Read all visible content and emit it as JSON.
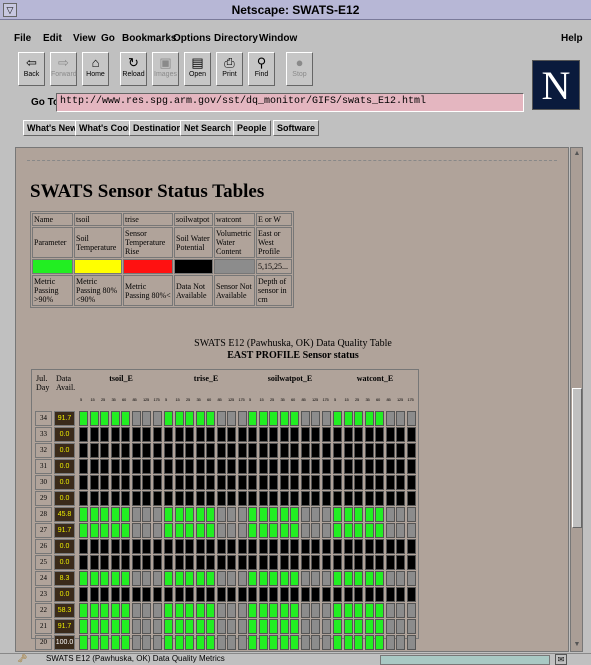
{
  "window": {
    "title": "Netscape: SWATS-E12",
    "control_glyph": "▽"
  },
  "menu": {
    "items": [
      "File",
      "Edit",
      "View",
      "Go",
      "Bookmarks",
      "Options",
      "Directory",
      "Window"
    ],
    "help": "Help"
  },
  "toolbar": {
    "buttons": [
      {
        "label": "Back",
        "icon": "back-arrow-icon",
        "enabled": true
      },
      {
        "label": "Forward",
        "icon": "forward-arrow-icon",
        "enabled": false
      },
      {
        "label": "Home",
        "icon": "home-icon",
        "enabled": true
      },
      {
        "label": "Reload",
        "icon": "reload-icon",
        "enabled": true
      },
      {
        "label": "Images",
        "icon": "images-icon",
        "enabled": false
      },
      {
        "label": "Open",
        "icon": "open-icon",
        "enabled": true
      },
      {
        "label": "Print",
        "icon": "print-icon",
        "enabled": true
      },
      {
        "label": "Find",
        "icon": "find-icon",
        "enabled": true
      },
      {
        "label": "Stop",
        "icon": "stop-icon",
        "enabled": false
      }
    ]
  },
  "goto": {
    "label": "Go To:",
    "url": "http://www.res.spg.arm.gov/sst/dq_monitor/GIFS/swats_E12.html"
  },
  "directory_buttons": [
    "What's New?",
    "What's Cool?",
    "Destinations",
    "Net Search",
    "People",
    "Software"
  ],
  "logo": {
    "letter": "N"
  },
  "page": {
    "heading": "SWATS Sensor Status Tables",
    "legend": {
      "rows": [
        [
          "Name",
          "tsoil",
          "trise",
          "soilwatpot",
          "watcont",
          "E or W"
        ],
        [
          "Parameter",
          "Soil Temperature",
          "Sensor Temperature Rise",
          "Soil Water Potential",
          "Volumetric Water Content",
          "East or West Profile"
        ],
        [
          "",
          "",
          "",
          "",
          "",
          "5,15,25..."
        ],
        [
          "Metric Passing >90%",
          "Metric Passing 80%<90%",
          "Metric Passing 80%<",
          "Data Not Available",
          "Sensor Not Available",
          "Depth of sensor in cm"
        ]
      ],
      "swatch_colors": [
        "#22ee22",
        "#ffff00",
        "#ff1111",
        "#000000",
        "#8c8c8c"
      ]
    },
    "dq_title": "SWATS E12 (Pawhuska, OK) Data Quality Table",
    "dq_subtitle": "EAST PROFILE Sensor status",
    "dq_table": {
      "col_day": "Jul. Day",
      "col_avail": "Data Avail.",
      "groups": [
        "tsoil_E",
        "trise_E",
        "soilwatpot_E",
        "watcont_E"
      ],
      "depths": [
        "5",
        "15",
        "25",
        "35",
        "60",
        "85",
        "125",
        "175"
      ],
      "days": [
        "34",
        "33",
        "32",
        "31",
        "30",
        "29",
        "28",
        "27",
        "26",
        "25",
        "24",
        "23",
        "22",
        "21",
        "20"
      ],
      "avail": [
        "91.7",
        "0.0",
        "0.0",
        "0.0",
        "0.0",
        "0.0",
        "45.8",
        "91.7",
        "0.0",
        "0.0",
        "8.3",
        "0.0",
        "58.3",
        "91.7",
        "100.0"
      ],
      "status_key": {
        "G": "metric passing >90%",
        "K": "data not available",
        "N": "sensor not available"
      },
      "group_pattern": [
        "G",
        "G",
        "G",
        "G",
        "G",
        "N",
        "N",
        "N"
      ],
      "row_status": [
        "pattern",
        "K",
        "K",
        "K",
        "K",
        "K",
        "pattern",
        "pattern",
        "K",
        "K",
        "pattern",
        "K",
        "pattern",
        "pattern",
        "pattern"
      ],
      "colors": {
        "G": "#22ee22",
        "K": "#000000",
        "N": "#8c8c8c",
        "avail_text": "#eeee00",
        "avail_text_full": "#ffffff"
      }
    }
  },
  "status": {
    "text": "SWATS E12 (Pawhuska, OK) Data Quality Metrics",
    "mail_glyph": "✉",
    "security_glyph": "🗝"
  }
}
